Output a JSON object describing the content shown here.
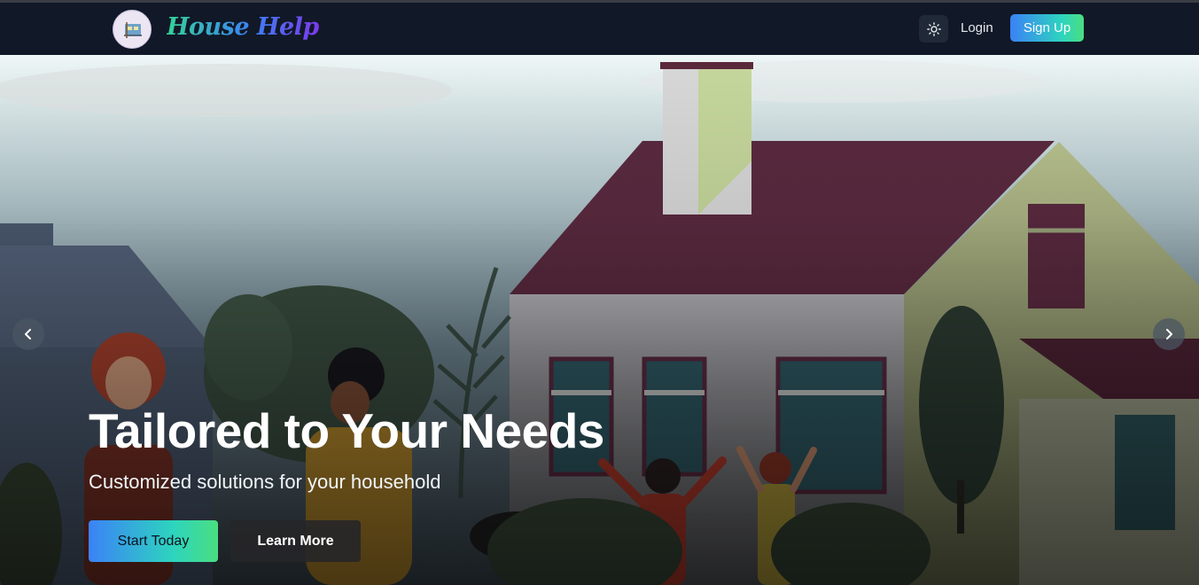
{
  "navbar": {
    "brand": "House Help",
    "login_label": "Login",
    "signup_label": "Sign Up",
    "icons": {
      "logo": "house-help-logo",
      "theme_toggle": "sun-icon"
    }
  },
  "hero": {
    "title": "Tailored to Your Needs",
    "subtitle": "Customized solutions for your household",
    "primary_cta": "Start Today",
    "secondary_cta": "Learn More",
    "icons": {
      "prev": "chevron-left-icon",
      "next": "chevron-right-icon"
    }
  },
  "colors": {
    "navbar_bg": "#111827",
    "accent_gradient_start": "#3b82f6",
    "accent_gradient_end": "#4ade80"
  }
}
